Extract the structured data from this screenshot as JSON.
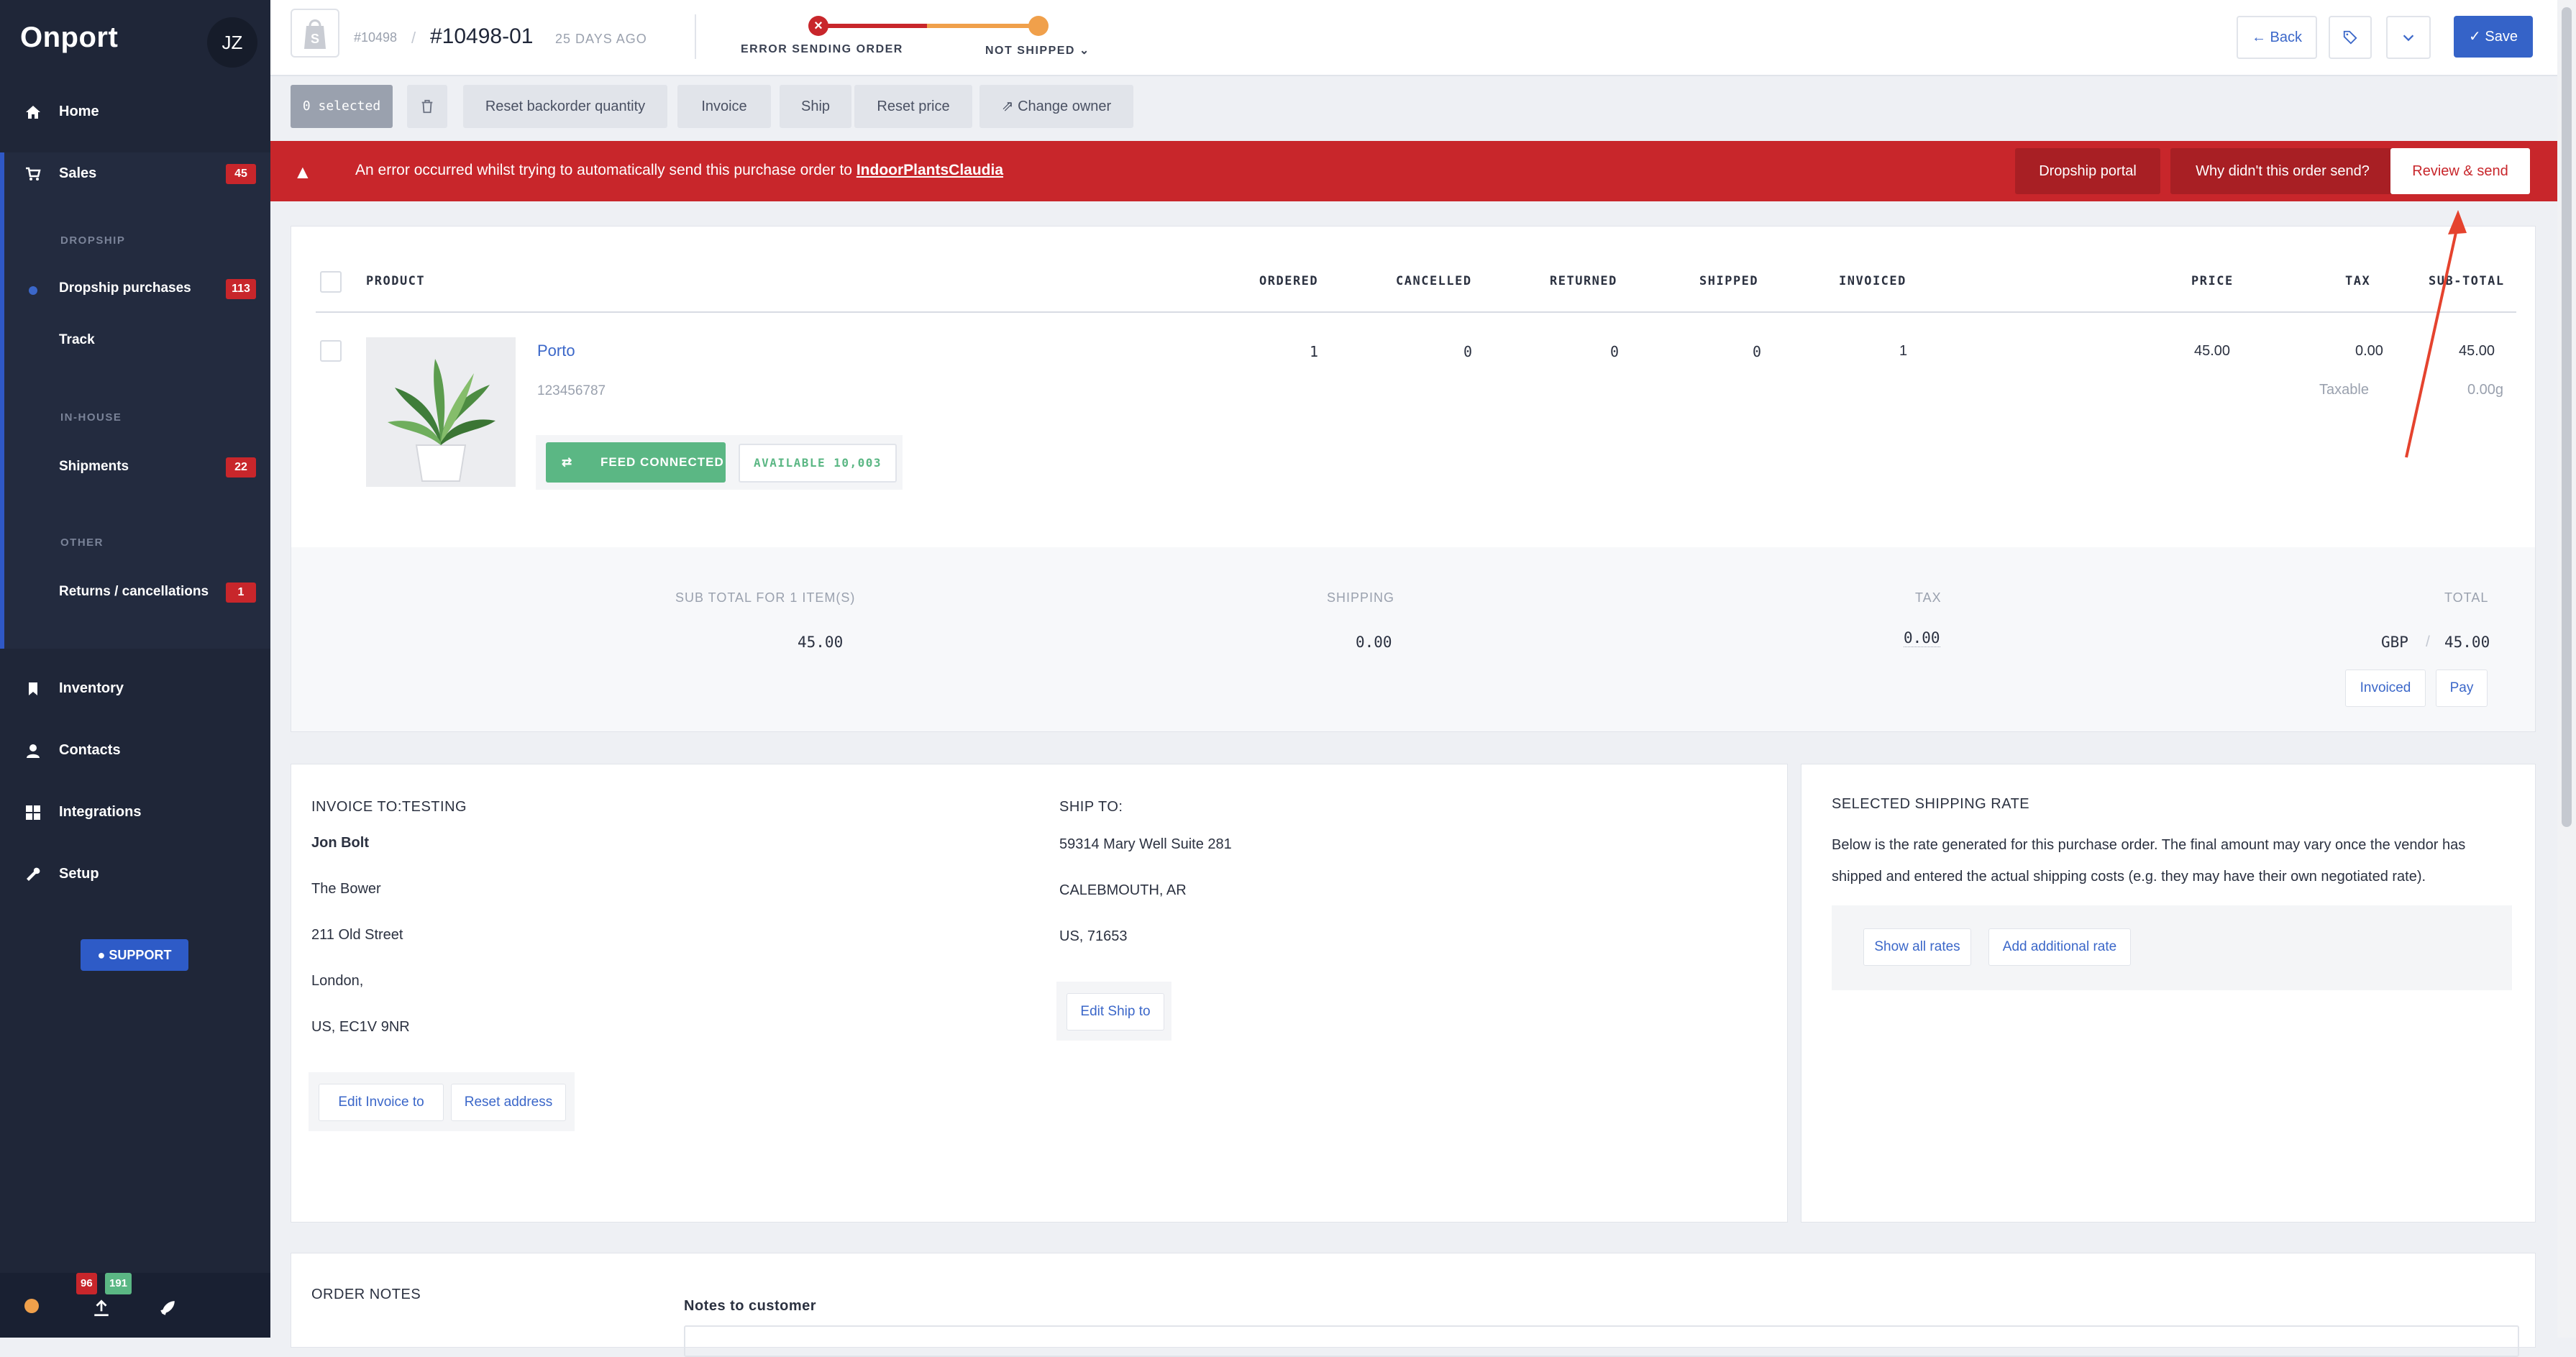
{
  "sidebar": {
    "brand": "Onport",
    "avatar": "JZ",
    "home": "Home",
    "sales": "Sales",
    "sales_badge": "45",
    "section_dropship": "DROPSHIP",
    "dropship_purchases": "Dropship purchases",
    "dropship_badge": "113",
    "track": "Track",
    "section_inhouse": "IN-HOUSE",
    "shipments": "Shipments",
    "shipments_badge": "22",
    "section_other": "OTHER",
    "returns": "Returns / cancellations",
    "returns_badge": "1",
    "inventory": "Inventory",
    "contacts": "Contacts",
    "integrations": "Integrations",
    "setup": "Setup",
    "support": "SUPPORT",
    "footer_badge_red": "96",
    "footer_badge_green": "191"
  },
  "header": {
    "parent_order": "#10498",
    "order_number": "#10498-01",
    "age": "25 DAYS AGO",
    "status_error": "ERROR SENDING ORDER",
    "status_shipping": "NOT SHIPPED",
    "back": "Back",
    "save": "Save"
  },
  "toolbar": {
    "selected": "0 selected",
    "reset_backorder": "Reset backorder quantity",
    "invoice": "Invoice",
    "ship": "Ship",
    "reset_price": "Reset price",
    "change_owner": "Change owner"
  },
  "error_banner": {
    "message": "An error occurred whilst trying to automatically send this purchase order to ",
    "vendor": "IndoorPlantsClaudia",
    "dropship_portal": "Dropship portal",
    "why": "Why didn't this order send?",
    "review": "Review & send"
  },
  "table": {
    "columns": [
      "PRODUCT",
      "ORDERED",
      "CANCELLED",
      "RETURNED",
      "SHIPPED",
      "INVOICED",
      "PRICE",
      "TAX",
      "SUB-TOTAL"
    ],
    "row": {
      "name": "Porto",
      "sku": "123456787",
      "feed": "FEED CONNECTED",
      "available": "AVAILABLE 10,003",
      "ordered": "1",
      "cancelled": "0",
      "returned": "0",
      "shipped": "0",
      "invoiced": "1",
      "price": "45.00",
      "tax": "0.00",
      "tax_type": "Taxable",
      "subtotal": "45.00",
      "subtotal_tax": "0.00g"
    }
  },
  "totals": {
    "subtotal_label": "SUB TOTAL FOR 1 ITEM(S)",
    "subtotal": "45.00",
    "shipping_label": "SHIPPING",
    "shipping": "0.00",
    "tax_label": "TAX",
    "tax": "0.00",
    "total_label": "TOTAL",
    "currency": "GBP",
    "total": "45.00",
    "invoiced": "Invoiced",
    "pay": "Pay"
  },
  "invoice_to": {
    "title": "INVOICE TO:TESTING",
    "name": "Jon Bolt",
    "line1": "The Bower",
    "line2": "211 Old Street",
    "line3": "London,",
    "line4": "US, EC1V 9NR",
    "edit": "Edit Invoice to",
    "reset": "Reset address"
  },
  "ship_to": {
    "title": "SHIP TO:",
    "line1": "59314 Mary Well Suite 281",
    "line2": "CALEBMOUTH, AR",
    "line3": "US, 71653",
    "edit": "Edit Ship to"
  },
  "shipping_rate": {
    "title": "SELECTED SHIPPING RATE",
    "description": "Below is the rate generated for this purchase order. The final amount may vary once the vendor has shipped and entered the actual shipping costs (e.g. they may have their own negotiated rate).",
    "show_all": "Show all rates",
    "add_rate": "Add additional rate"
  },
  "notes": {
    "title": "ORDER NOTES",
    "customer_label": "Notes to customer"
  },
  "colors": {
    "sidebar": "#1f2638",
    "accent": "#3563c8",
    "error": "#c8262b",
    "warning": "#f0a04b",
    "success": "#5bb784"
  }
}
